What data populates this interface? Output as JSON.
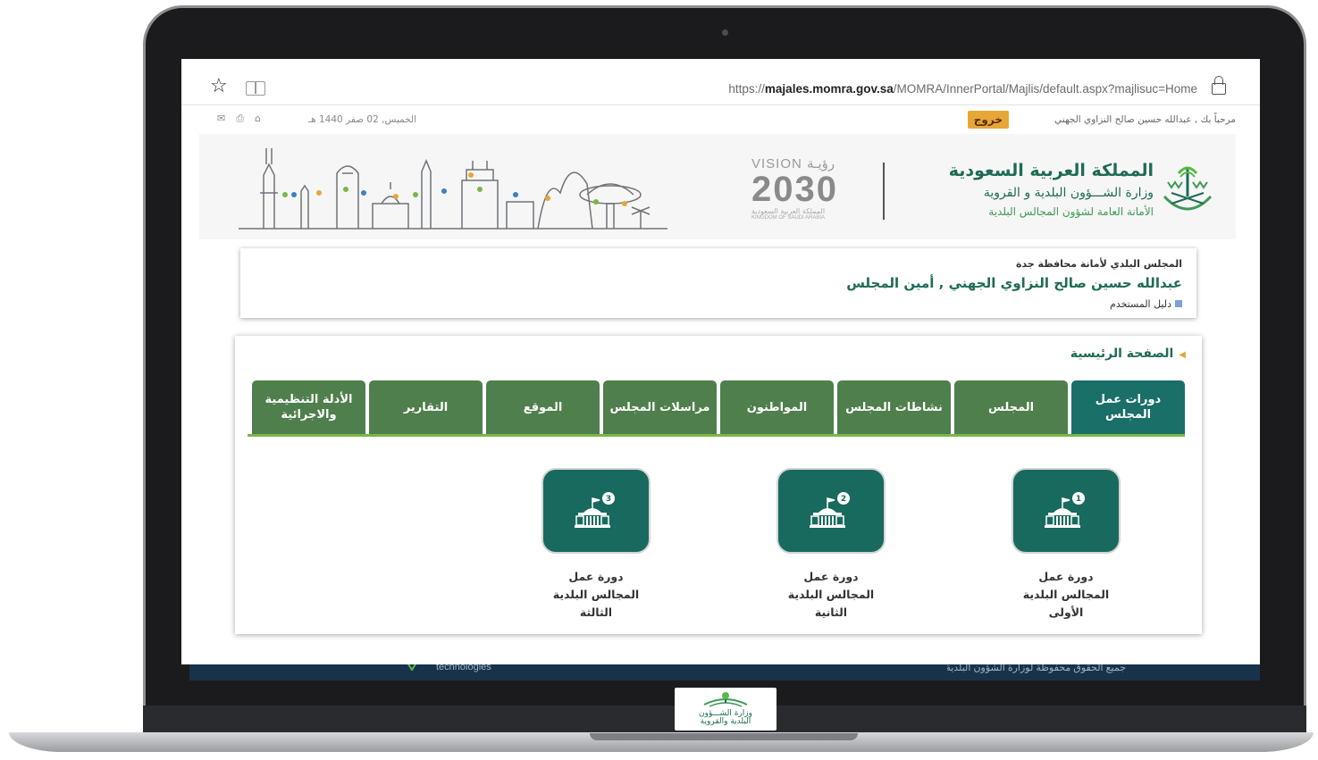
{
  "browser": {
    "url_prefix": "https://",
    "url_host": "majales.momra.gov.sa",
    "url_path": "/MOMRA/InnerPortal/Majlis/default.aspx?majlisuc=Home"
  },
  "topbar": {
    "welcome": "مرحباً بك , عبدالله حسين صالح النزاوي الجهني",
    "logout_label": "خروج",
    "date": "الخميس, 02 صفر 1440 هـ"
  },
  "header": {
    "kingdom": "المملكة العربية السعودية",
    "ministry": "وزارة الشـــؤون البلدية و القروية",
    "department": "الأمانة العامة لشؤون المجالس البلدية",
    "vision_top": "VISION رؤيـة",
    "vision_year": "2030",
    "vision_sub1": "المملكة العربية السعودية",
    "vision_sub2": "KINGDOM OF SAUDI ARABIA"
  },
  "council": {
    "name": "المجلس البلدي لأمانة محافظة جدة",
    "secretary": "عبدالله حسين صالح النزاوي الجهني , أمين المجلس",
    "guide_link": "دليل المستخدم"
  },
  "main": {
    "breadcrumb": "الصفحة الرئيسية",
    "tabs": [
      {
        "label": "دورات عمل المجلس",
        "active": true
      },
      {
        "label": "المجلس",
        "active": false
      },
      {
        "label": "نشاطات المجلس",
        "active": false
      },
      {
        "label": "المواطنون",
        "active": false
      },
      {
        "label": "مراسلات المجلس",
        "active": false
      },
      {
        "label": "الموقع",
        "active": false
      },
      {
        "label": "التقارير",
        "active": false
      },
      {
        "label": "الأدلة التنظيمية والاجرائية",
        "active": false
      }
    ],
    "tiles": [
      {
        "badge": "1",
        "line1": "دورة عمل",
        "line2": "المجالس البلدية",
        "line3": "الأولى"
      },
      {
        "badge": "2",
        "line1": "دورة عمل",
        "line2": "المجالس البلدية",
        "line3": "الثانية"
      },
      {
        "badge": "3",
        "line1": "دورة عمل",
        "line2": "المجالس البلدية",
        "line3": "الثالثة"
      }
    ]
  },
  "footer_strip": {
    "left_text": "technologies",
    "right_text": "جميع الحقوق محفوظة لوزارة الشؤون البلدية والقروية"
  },
  "bezel_logo": {
    "line1": "وزارة الشـــؤون",
    "line2": "البلدية والقروية"
  },
  "colors": {
    "tab_green": "#4f7f4c",
    "tab_active": "#1a6f69",
    "tile_green": "#196a5e",
    "brand_green": "#1f6b55",
    "logout_orange": "#e6a737"
  }
}
